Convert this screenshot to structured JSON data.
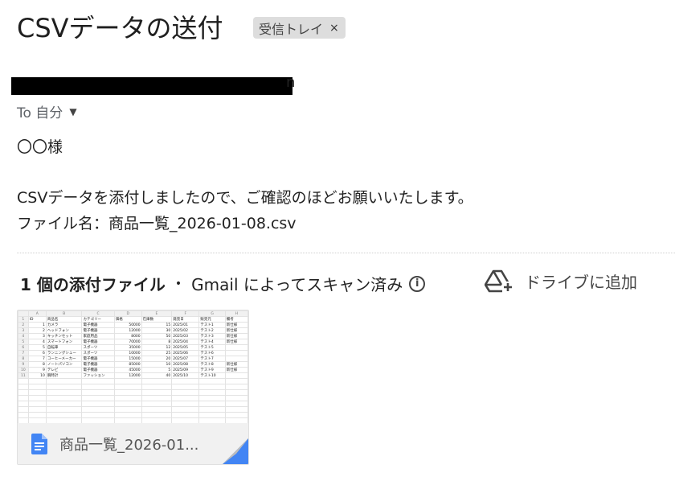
{
  "email": {
    "subject": "CSVデータの送付",
    "label": "受信トレイ",
    "label_close": "×",
    "sender_visible_suffix": "n",
    "to_label": "To 自分",
    "body": {
      "greeting": "〇〇様",
      "line1": "CSVデータを添付しましたので、ご確認のほどお願いいたします。",
      "line2": "ファイル名：商品一覧_2026-01-08.csv"
    }
  },
  "attachments": {
    "count_label": "1 個の添付ファイル",
    "scan_label": "Gmail によってスキャン済み",
    "drive_label": "ドライブに追加",
    "card_name": "商品一覧_2026-01...",
    "icons": {
      "info": "info-icon",
      "drive": "drive-add-icon",
      "doc": "google-docs-icon"
    },
    "colors": {
      "doc_blue": "#4285f4"
    },
    "thumbnail": {
      "columns": [
        "",
        "A",
        "B",
        "C",
        "D",
        "E",
        "F",
        "G",
        "H"
      ],
      "rows": [
        [
          "1",
          "ID",
          "商品名",
          "カテゴリー",
          "価格",
          "在庫数",
          "発売日",
          "販売元",
          "備考"
        ],
        [
          "2",
          "1",
          "カメラ",
          "電子機器",
          "50000",
          "15",
          "2025/01",
          "テスト1",
          "新仕様"
        ],
        [
          "3",
          "2",
          "ヘッドフォン",
          "電子機器",
          "12000",
          "30",
          "2025/02",
          "テスト2",
          "新仕様"
        ],
        [
          "4",
          "3",
          "キッチンセット",
          "家庭用品",
          "8000",
          "50",
          "2025/03",
          "テスト3",
          "新仕様"
        ],
        [
          "5",
          "4",
          "スマートフォン",
          "電子機器",
          "70000",
          "8",
          "2025/04",
          "テスト4",
          "新仕様"
        ],
        [
          "6",
          "5",
          "自転車",
          "スポーツ",
          "35000",
          "12",
          "2025/05",
          "テスト5",
          ""
        ],
        [
          "7",
          "6",
          "ランニングシュー",
          "スポーツ",
          "10000",
          "25",
          "2025/06",
          "テスト6",
          ""
        ],
        [
          "8",
          "7",
          "コーヒーメーカー",
          "電子機器",
          "15000",
          "20",
          "2025/07",
          "テスト7",
          ""
        ],
        [
          "9",
          "8",
          "ノートパソコン",
          "電子機器",
          "85000",
          "10",
          "2025/08",
          "テスト8",
          "新仕様"
        ],
        [
          "10",
          "9",
          "テレビ",
          "電子機器",
          "45000",
          "5",
          "2025/09",
          "テスト9",
          "新仕様"
        ],
        [
          "11",
          "10",
          "腕時計",
          "ファッション",
          "12000",
          "40",
          "2025/10",
          "テスト10",
          ""
        ]
      ]
    }
  }
}
